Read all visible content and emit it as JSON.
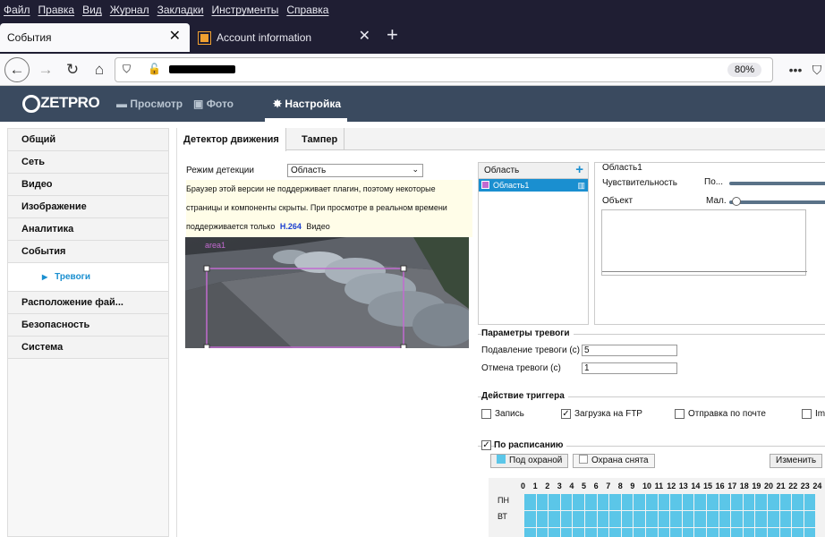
{
  "browser": {
    "menu": [
      "Файл",
      "Правка",
      "Вид",
      "Журнал",
      "Закладки",
      "Инструменты",
      "Справка"
    ],
    "tabs": [
      {
        "title": "События"
      },
      {
        "title": "Account information"
      }
    ],
    "zoom": "80%"
  },
  "app": {
    "logo": "ZETPRO",
    "nav": [
      {
        "label": "Просмотр"
      },
      {
        "label": "Фото"
      },
      {
        "label": "Настройка"
      }
    ]
  },
  "sidebar": {
    "items": [
      {
        "label": "Общий"
      },
      {
        "label": "Сеть"
      },
      {
        "label": "Видео"
      },
      {
        "label": "Изображение"
      },
      {
        "label": "Аналитика"
      },
      {
        "label": "События"
      }
    ],
    "sub": "Тревоги",
    "items2": [
      {
        "label": "Расположение фай..."
      },
      {
        "label": "Безопасность"
      },
      {
        "label": "Система"
      }
    ]
  },
  "content": {
    "tabs": [
      {
        "label": "Детектор движения"
      },
      {
        "label": "Тампер"
      }
    ],
    "mode_label": "Режим детекции",
    "mode_value": "Область",
    "warning": {
      "line1": "Браузер этой версии не поддерживает плагин, поэтому некоторые",
      "line2": "страницы и компоненты скрыты. При просмотре в реальном времени",
      "line3a": "поддерживается только",
      "codec": "H.264",
      "line3b": "Видео"
    },
    "overlay_label": "area1",
    "area_list": {
      "header": "Область",
      "item": "Область1"
    },
    "area_detail": {
      "title": "Область1",
      "sensitivity_label": "Чувствительность",
      "sensitivity_value": "По...",
      "object_label": "Объект",
      "object_value": "Мал."
    },
    "alarm": {
      "title": "Параметры тревоги",
      "suppress_label": "Подавление тревоги (с)",
      "suppress_value": "5",
      "cancel_label": "Отмена тревоги (с)",
      "cancel_value": "1"
    },
    "trigger": {
      "title": "Действие триггера",
      "options": [
        {
          "label": "Запись",
          "checked": false
        },
        {
          "label": "Загрузка на FTP",
          "checked": true
        },
        {
          "label": "Отправка по почте",
          "checked": false
        },
        {
          "label": "Im",
          "checked": false
        }
      ]
    },
    "schedule": {
      "title": "По расписанию",
      "checked": true,
      "armed_label": "Под охраной",
      "disarmed_label": "Охрана снята",
      "edit_label": "Изменить",
      "hours": [
        "0",
        "1",
        "2",
        "3",
        "4",
        "5",
        "6",
        "7",
        "8",
        "9",
        "10",
        "11",
        "12",
        "13",
        "14",
        "15",
        "16",
        "17",
        "18",
        "19",
        "20",
        "21",
        "22",
        "23",
        "24"
      ],
      "days": [
        "ПН",
        "ВТ"
      ],
      "armed_color": "#5bc6e8"
    }
  }
}
